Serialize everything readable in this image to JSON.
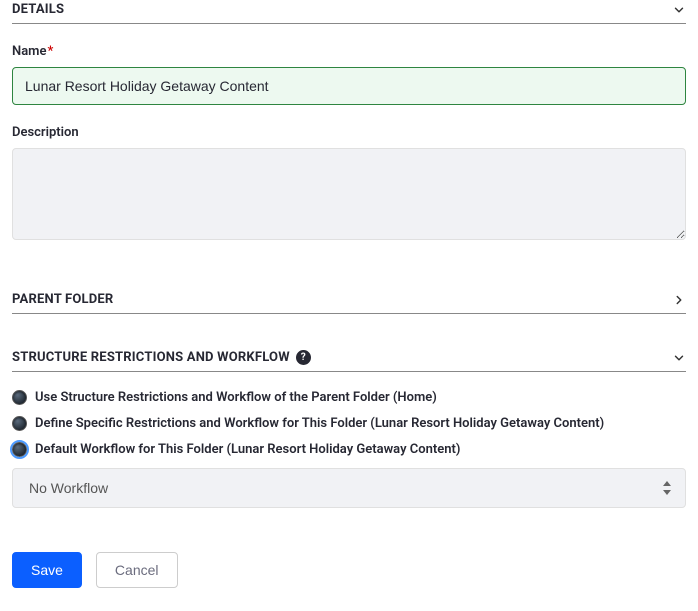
{
  "sections": {
    "details": {
      "title": "DETAILS"
    },
    "parentFolder": {
      "title": "PARENT FOLDER"
    },
    "structure": {
      "title": "STRUCTURE RESTRICTIONS AND WORKFLOW"
    }
  },
  "fields": {
    "name": {
      "label": "Name",
      "required": "*",
      "value": "Lunar Resort Holiday Getaway Content"
    },
    "description": {
      "label": "Description",
      "value": ""
    }
  },
  "workflow": {
    "options": [
      {
        "label": "Use Structure Restrictions and Workflow of the Parent Folder (Home)",
        "selected": false
      },
      {
        "label": "Define Specific Restrictions and Workflow for This Folder (Lunar Resort Holiday Getaway Content)",
        "selected": false
      },
      {
        "label": "Default Workflow for This Folder (Lunar Resort Holiday Getaway Content)",
        "selected": true
      }
    ],
    "select": {
      "value": "No Workflow"
    }
  },
  "actions": {
    "save": "Save",
    "cancel": "Cancel"
  }
}
